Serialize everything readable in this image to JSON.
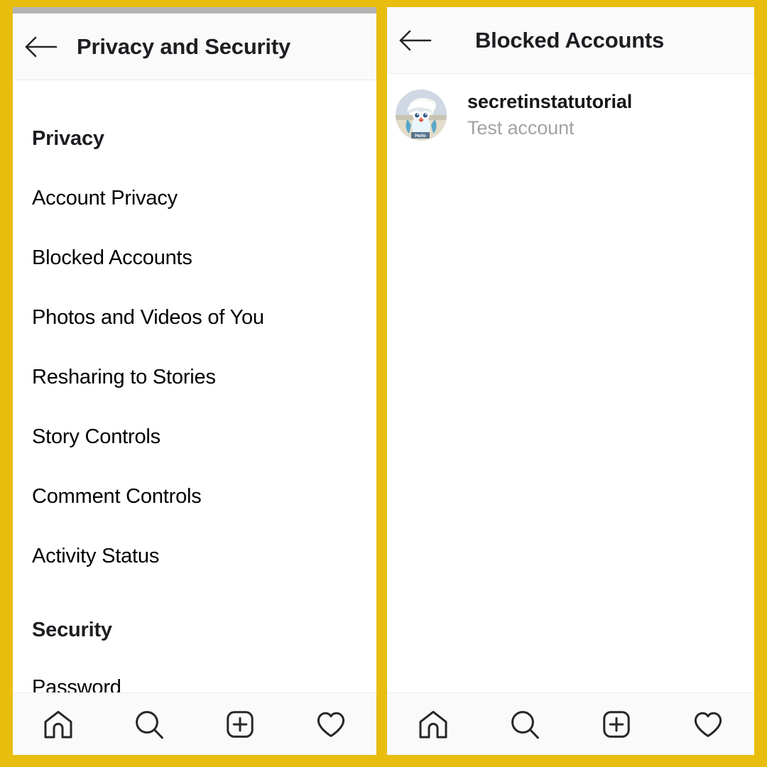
{
  "theme": {
    "border_color": "#e8bd0d",
    "panel_bg": "#ffffff",
    "appbar_bg": "#fafafa",
    "statusbar_color": "#b3b3b3",
    "text_primary": "#000000",
    "text_secondary": "#a3a3a3"
  },
  "left_panel": {
    "header": {
      "back_icon": "arrow-left-icon",
      "title": "Privacy and Security"
    },
    "sections": [
      {
        "header": "Privacy",
        "items": [
          {
            "label": "Account Privacy"
          },
          {
            "label": "Blocked Accounts"
          },
          {
            "label": "Photos and Videos of You"
          },
          {
            "label": "Resharing to Stories"
          },
          {
            "label": "Story Controls"
          },
          {
            "label": "Comment Controls"
          },
          {
            "label": "Activity Status"
          }
        ]
      },
      {
        "header": "Security",
        "items": [
          {
            "label": "Password"
          }
        ]
      }
    ]
  },
  "right_panel": {
    "header": {
      "back_icon": "arrow-left-icon",
      "title": "Blocked Accounts"
    },
    "blocked_accounts": [
      {
        "avatar": "penguin-avatar",
        "username": "secretinstatutorial",
        "full_name": "Test account"
      }
    ]
  },
  "bottom_nav": {
    "tabs": [
      {
        "icon": "home-icon",
        "label": "Home"
      },
      {
        "icon": "search-icon",
        "label": "Search"
      },
      {
        "icon": "add-post-icon",
        "label": "New Post"
      },
      {
        "icon": "heart-icon",
        "label": "Activity"
      }
    ]
  }
}
